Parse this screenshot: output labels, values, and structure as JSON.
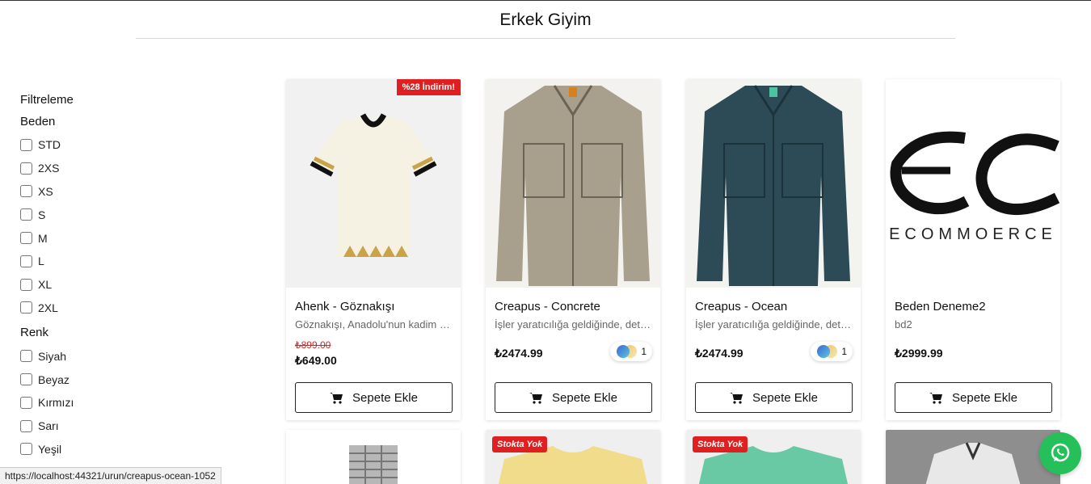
{
  "page": {
    "title": "Erkek Giyim"
  },
  "filters": {
    "heading": "Filtreleme",
    "size_title": "Beden",
    "sizes": [
      "STD",
      "2XS",
      "XS",
      "S",
      "M",
      "L",
      "XL",
      "2XL"
    ],
    "color_title": "Renk",
    "colors": [
      "Siyah",
      "Beyaz",
      "Kırmızı",
      "Sarı",
      "Yeşil"
    ]
  },
  "products": [
    {
      "badge": "%28 İndirim!",
      "name": "Ahenk - Göznakışı",
      "desc": "Göznakışı, Anadolu'nun kadim kültüründe…",
      "old_price": "₺899.00",
      "price": "₺649.00",
      "button": "Sepete Ekle"
    },
    {
      "name": "Creapus - Concrete",
      "desc": "İşler yaratıcılığa geldiğinde, detaylar önem kazanır",
      "price": "₺2474.99",
      "swatch_count": "1",
      "button": "Sepete Ekle"
    },
    {
      "name": "Creapus - Ocean",
      "desc": "İşler yaratıcılığa geldiğinde, detaylar önem kazanır",
      "price": "₺2474.99",
      "swatch_count": "1",
      "button": "Sepete Ekle"
    },
    {
      "name": "Beden Deneme2",
      "desc": "bd2",
      "price": "₺2999.99",
      "button": "Sepete Ekle",
      "logo_text": "ECOMMOERCE"
    }
  ],
  "row2_badges": [
    "Stokta Yok",
    "Stokta Yok"
  ],
  "status_bar": {
    "url": "https://localhost:44321/urun/creapus-ocean-1052"
  },
  "icons": {
    "cart": "cart-icon",
    "whatsapp": "whatsapp-icon"
  },
  "colors": {
    "sale": "#e02020",
    "whatsapp": "#25c05a"
  }
}
